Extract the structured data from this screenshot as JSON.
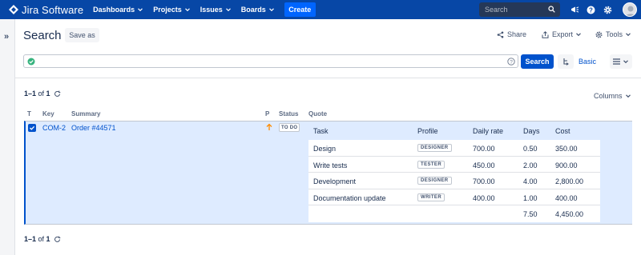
{
  "nav": {
    "logo_text": "Jira Software",
    "items": [
      {
        "label": "Dashboards"
      },
      {
        "label": "Projects"
      },
      {
        "label": "Issues"
      },
      {
        "label": "Boards"
      }
    ],
    "create_label": "Create",
    "search_placeholder": "Search",
    "brand_color": "#0747a6"
  },
  "header": {
    "title": "Search",
    "save_as": "Save as",
    "share": "Share",
    "export": "Export",
    "tools": "Tools"
  },
  "query": {
    "value": "",
    "search_button": "Search",
    "basic_link": "Basic"
  },
  "results": {
    "pager_range": "1–1",
    "pager_of": " of ",
    "pager_total": "1",
    "columns_button": "Columns",
    "column_headers": {
      "type": "T",
      "key": "Key",
      "summary": "Summary",
      "priority": "P",
      "status": "Status",
      "quote": "Quote"
    },
    "row": {
      "key": "COM-2",
      "summary": "Order #44571",
      "status": "TO DO",
      "selected": true
    }
  },
  "quote": {
    "headers": {
      "task": "Task",
      "profile": "Profile",
      "rate": "Daily rate",
      "days": "Days",
      "cost": "Cost"
    },
    "rows": [
      {
        "task": "Design",
        "profile": "DESIGNER",
        "rate": "700.00",
        "days": "0.50",
        "cost": "350.00"
      },
      {
        "task": "Write tests",
        "profile": "TESTER",
        "rate": "450.00",
        "days": "2.00",
        "cost": "900.00"
      },
      {
        "task": "Development",
        "profile": "DESIGNER",
        "rate": "700.00",
        "days": "4.00",
        "cost": "2,800.00"
      },
      {
        "task": "Documentation update",
        "profile": "WRITER",
        "rate": "400.00",
        "days": "1.00",
        "cost": "400.00"
      }
    ],
    "totals": {
      "days": "7.50",
      "cost": "4,450.00"
    }
  }
}
